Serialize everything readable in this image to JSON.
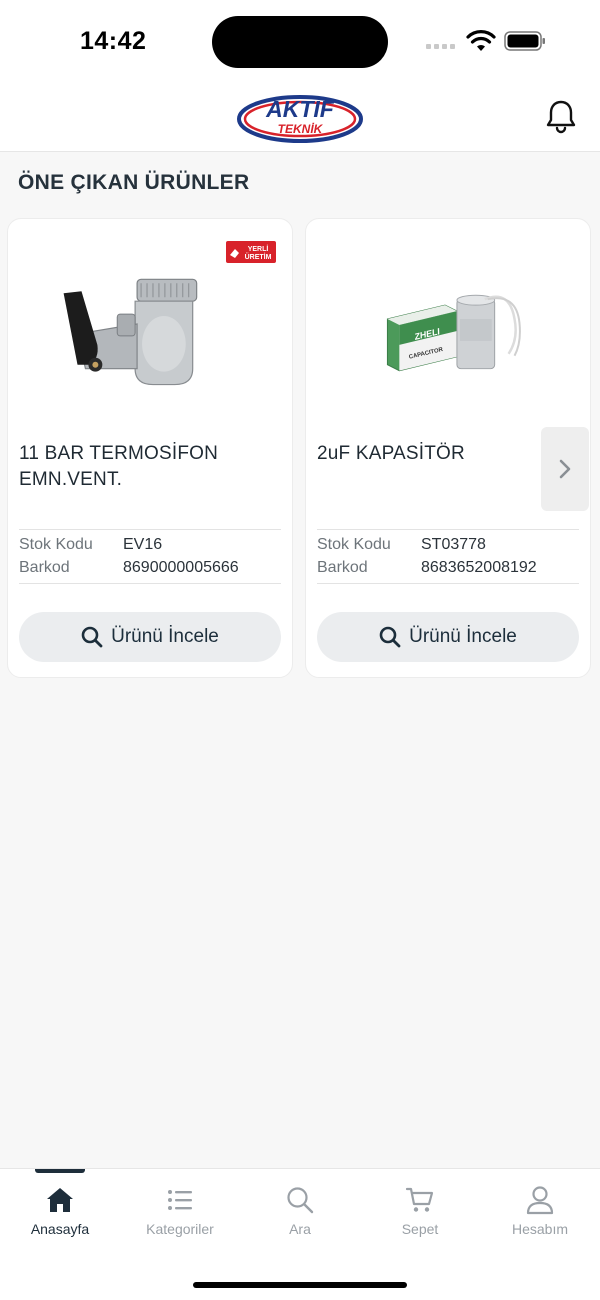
{
  "status_bar": {
    "time": "14:42"
  },
  "header": {
    "logo_text_top": "AKTİF",
    "logo_text_bottom": "TEKNİK",
    "bell_icon": "bell-icon"
  },
  "section": {
    "title": "ÖNE ÇIKAN ÜRÜNLER"
  },
  "products": [
    {
      "name": "11 BAR TERMOSİFON EMN.VENT.",
      "badge_text_line1": "YERLİ",
      "badge_text_line2": "ÜRETİM",
      "stock_label": "Stok Kodu",
      "stock_value": "EV16",
      "barcode_label": "Barkod",
      "barcode_value": "8690000005666",
      "button_label": "Ürünü İncele"
    },
    {
      "name": "2uF KAPASİTÖR",
      "product_box_text": "ZHELI",
      "product_box_subtext": "CAPACITOR",
      "stock_label": "Stok Kodu",
      "stock_value": "ST03778",
      "barcode_label": "Barkod",
      "barcode_value": "8683652008192",
      "button_label": "Ürünü İncele"
    }
  ],
  "tabs": [
    {
      "label": "Anasayfa",
      "icon": "home-icon",
      "active": true
    },
    {
      "label": "Kategoriler",
      "icon": "list-icon",
      "active": false
    },
    {
      "label": "Ara",
      "icon": "search-icon",
      "active": false
    },
    {
      "label": "Sepet",
      "icon": "cart-icon",
      "active": false
    },
    {
      "label": "Hesabım",
      "icon": "user-icon",
      "active": false
    }
  ],
  "colors": {
    "brand_red": "#d8222a",
    "brand_blue": "#1d3a8a",
    "dark": "#1e2e3b",
    "inactive": "#9aa0a6"
  }
}
